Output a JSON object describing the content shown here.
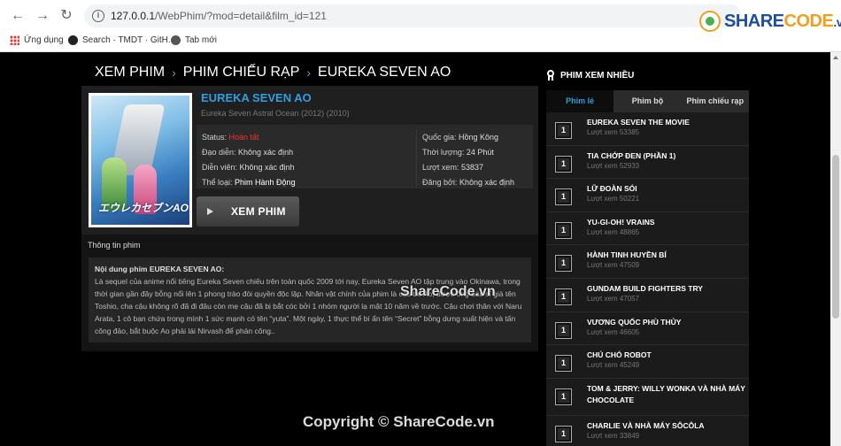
{
  "browser": {
    "url_host": "127.0.0.1",
    "url_path": "/WebPhim/?mod=detail&film_id=121",
    "bookmarks": [
      "Ứng dụng",
      "Search · TMDT · GitH...",
      "Tab mới"
    ],
    "brand_text_main": "SHARE",
    "brand_text_accent": "CODE",
    "brand_tld": ".vn"
  },
  "breadcrumb": [
    "XEM PHIM",
    "PHIM CHIẾU RẠP",
    "EUREKA SEVEN AO"
  ],
  "breadcrumb_sep": "›",
  "film": {
    "poster_logo": "エウレカセブンAO",
    "title": "EUREKA SEVEN AO",
    "subtitle": "Eureka Seven Astral Ocean (2012) (2010)",
    "left_meta": [
      {
        "label": "Status: ",
        "value": "Hoàn tất"
      },
      {
        "label": "Đạo diễn: ",
        "value": "Không xác định"
      },
      {
        "label": "Diễn viên: ",
        "value": "Không xác định"
      },
      {
        "label": "Thể loại: ",
        "value": "Phim Hành Động"
      }
    ],
    "right_meta": [
      {
        "label": "Quốc gia: ",
        "value": "Hồng Kông"
      },
      {
        "label": "Thời lượng: ",
        "value": "24 Phút"
      },
      {
        "label": "Lượt xem: ",
        "value": "53837"
      },
      {
        "label": "Đăng bởi: ",
        "value": "Không xác định"
      }
    ],
    "watch_label": "XEM PHIM",
    "info_label": "Thông tin phim",
    "desc_heading": "Nội dung phim EUREKA SEVEN AO:",
    "desc_body": "Là sequel của anime nổi tiếng Eureka Seven chiếu trên toàn quốc 2009 tới nay, Eureka Seven AO tập trung vào Okinawa, trong thời gian gần đây bỗng nổi lên 1 phong trào đòi quyền độc lập. Nhân vật chính của phim là cậu bé Ao, được ông bác sĩ già tên Toshio, cha cậu không rõ đã đi đâu còn mẹ cậu đã bị bắt cóc bởi 1 nhóm người lạ mặt 10 năm về trước. Cậu chơi thân với Naru Arata, 1 cô bạn chứa trong mình 1 sức mạnh có tên “yuta”. Một ngày, 1 thực thể bí ẩn tên “Secret” bỗng dưng xuất hiện và tấn công đảo, bắt buộc Ao phải lái Nirvash để phản công.."
  },
  "watermarks": {
    "overlay": "ShareCode.vn",
    "footer": "Copyright © ShareCode.vn"
  },
  "sidebar": {
    "heading": "PHIM XEM NHIỀU",
    "tabs": [
      "Phim lẻ",
      "Phim bộ",
      "Phim chiếu rạp"
    ],
    "views_prefix": "Lượt xem ",
    "items": [
      {
        "rank": "1",
        "title": "EUREKA SEVEN THE MOVIE",
        "views": "53385"
      },
      {
        "rank": "1",
        "title": "TIA CHỚP ĐEN (PHẦN 1)",
        "views": "52933"
      },
      {
        "rank": "1",
        "title": "LỮ ĐOÀN SÓI",
        "views": "50221"
      },
      {
        "rank": "1",
        "title": "YU-GI-OH! VRAINS",
        "views": "48865"
      },
      {
        "rank": "1",
        "title": "HÀNH TINH HUYỀN BÍ",
        "views": "47509"
      },
      {
        "rank": "1",
        "title": "GUNDAM BUILD FIGHTERS TRY",
        "views": "47057"
      },
      {
        "rank": "1",
        "title": "VƯƠNG QUỐC PHÙ THỦY",
        "views": "46605"
      },
      {
        "rank": "1",
        "title": "CHÚ CHÓ ROBOT",
        "views": "45249"
      },
      {
        "rank": "1",
        "title": "TOM & JERRY: WILLY WONKA VÀ NHÀ MÁY CHOCOLATE",
        "views": ""
      },
      {
        "rank": "1",
        "title": "CHARLIE VÀ NHÀ MÁY SÔCÔLA",
        "views": "33849"
      }
    ]
  }
}
